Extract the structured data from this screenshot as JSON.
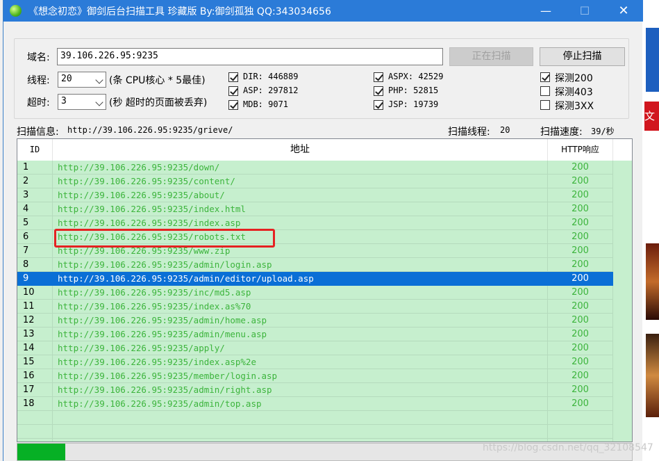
{
  "window": {
    "title": "《想念初恋》御剑后台扫描工具 珍藏版 By:御剑孤独 QQ:343034656",
    "min_glyph": "—",
    "max_glyph": "☐",
    "close_glyph": "✕"
  },
  "form": {
    "domain_label": "域名:",
    "domain_value": "39.106.226.95:9235",
    "scanning_button": "正在扫描",
    "stop_button": "停止扫描",
    "threads_label": "线程:",
    "threads_value": "20",
    "threads_hint": "(条 CPU核心 * 5最佳)",
    "timeout_label": "超时:",
    "timeout_value": "3",
    "timeout_hint": "(秒 超时的页面被丢弃)"
  },
  "dicts": [
    {
      "label": "DIR: 446889",
      "checked": true
    },
    {
      "label": "ASP: 297812",
      "checked": true
    },
    {
      "label": "MDB: 9071",
      "checked": true
    },
    {
      "label": "ASPX: 42529",
      "checked": true
    },
    {
      "label": "PHP: 52815",
      "checked": true
    },
    {
      "label": "JSP: 19739",
      "checked": true
    }
  ],
  "probes": [
    {
      "label": "探测200",
      "checked": true
    },
    {
      "label": "探测403",
      "checked": false
    },
    {
      "label": "探测3XX",
      "checked": false
    }
  ],
  "status": {
    "info_label": "扫描信息:",
    "info_value": "http://39.106.226.95:9235/grieve/",
    "threads_label": "扫描线程:",
    "threads_value": "20",
    "speed_label": "扫描速度:",
    "speed_value": "39/秒"
  },
  "table": {
    "headers": {
      "id": "ID",
      "url": "地址",
      "http": "HTTP响应"
    },
    "selected_index": 8,
    "rows": [
      {
        "id": "1",
        "url": "http://39.106.226.95:9235/down/",
        "http": "200"
      },
      {
        "id": "2",
        "url": "http://39.106.226.95:9235/content/",
        "http": "200"
      },
      {
        "id": "3",
        "url": "http://39.106.226.95:9235/about/",
        "http": "200"
      },
      {
        "id": "4",
        "url": "http://39.106.226.95:9235/index.html",
        "http": "200"
      },
      {
        "id": "5",
        "url": "http://39.106.226.95:9235/index.asp",
        "http": "200"
      },
      {
        "id": "6",
        "url": "http://39.106.226.95:9235/robots.txt",
        "http": "200"
      },
      {
        "id": "7",
        "url": "http://39.106.226.95:9235/www.zip",
        "http": "200"
      },
      {
        "id": "8",
        "url": "http://39.106.226.95:9235/admin/login.asp",
        "http": "200"
      },
      {
        "id": "9",
        "url": "http://39.106.226.95:9235/admin/editor/upload.asp",
        "http": "200"
      },
      {
        "id": "10",
        "url": "http://39.106.226.95:9235/inc/md5.asp",
        "http": "200"
      },
      {
        "id": "11",
        "url": "http://39.106.226.95:9235/index.as%70",
        "http": "200"
      },
      {
        "id": "12",
        "url": "http://39.106.226.95:9235/admin/home.asp",
        "http": "200"
      },
      {
        "id": "13",
        "url": "http://39.106.226.95:9235/admin/menu.asp",
        "http": "200"
      },
      {
        "id": "14",
        "url": "http://39.106.226.95:9235/apply/",
        "http": "200"
      },
      {
        "id": "15",
        "url": "http://39.106.226.95:9235/index.asp%2e",
        "http": "200"
      },
      {
        "id": "16",
        "url": "http://39.106.226.95:9235/member/login.asp",
        "http": "200"
      },
      {
        "id": "17",
        "url": "http://39.106.226.95:9235/admin/right.asp",
        "http": "200"
      },
      {
        "id": "18",
        "url": "http://39.106.226.95:9235/admin/top.asp",
        "http": "200"
      }
    ]
  },
  "progress": {
    "fraction": 0.078
  },
  "watermark": "https://blog.csdn.net/qq_32108547",
  "background_tag": "文章",
  "colors": {
    "titlebar": "#2b7bd8",
    "row_bg": "#c6efce",
    "row_text": "#3cb43c",
    "selected": "#0a6fd6",
    "highlight": "#e52222",
    "progress": "#06b025"
  }
}
